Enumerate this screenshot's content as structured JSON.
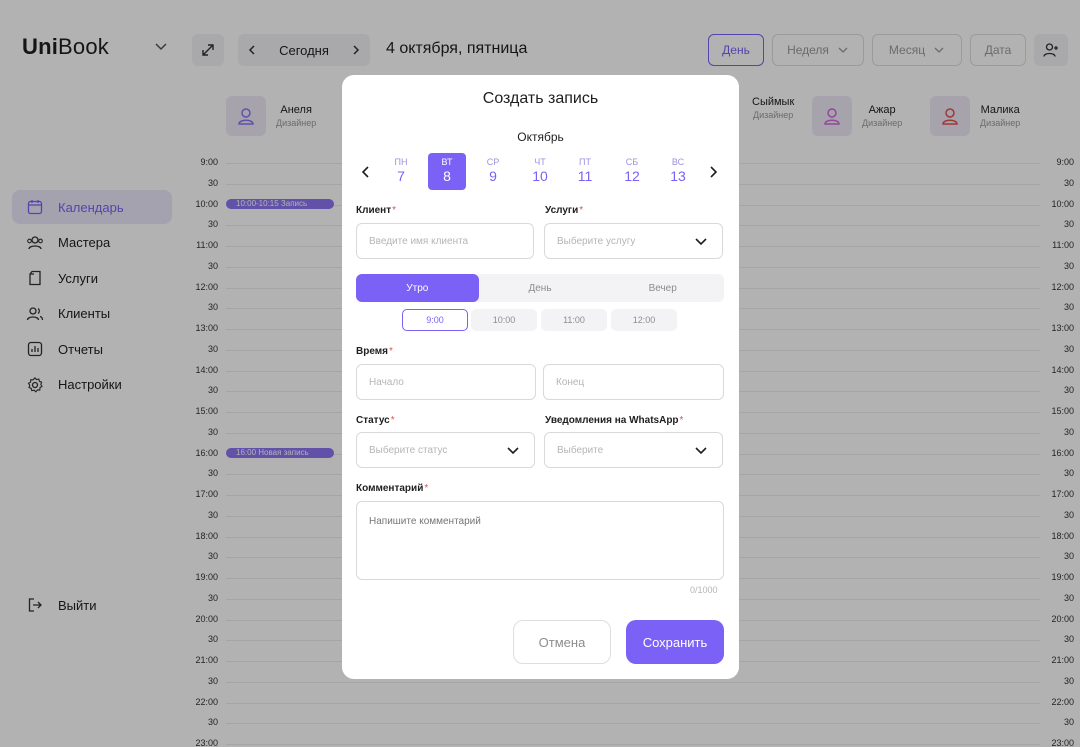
{
  "app": {
    "logo_bold": "Uni",
    "logo_rest": "Book"
  },
  "sidebar": {
    "items": [
      {
        "label": "Календарь",
        "icon": "calendar-icon",
        "active": true
      },
      {
        "label": "Мастера",
        "icon": "users-icon"
      },
      {
        "label": "Услуги",
        "icon": "box-icon"
      },
      {
        "label": "Клиенты",
        "icon": "clients-icon"
      },
      {
        "label": "Отчеты",
        "icon": "chart-icon"
      },
      {
        "label": "Настройки",
        "icon": "gear-icon"
      }
    ],
    "logout": "Выйти"
  },
  "topbar": {
    "today": "Сегодня",
    "date_title": "4 октября, пятница",
    "views": {
      "day": "День",
      "week": "Неделя",
      "month": "Месяц",
      "date": "Дата"
    }
  },
  "masters": [
    {
      "name": "Анеля",
      "role": "Дизайнер",
      "color": "#8b74f3"
    },
    {
      "name": "Сыймык",
      "role": "Дизайнер",
      "color": "#8b74f3"
    },
    {
      "name": "Ажар",
      "role": "Дизайнер",
      "color": "#d06ad8"
    },
    {
      "name": "Малика",
      "role": "Дизайнер",
      "color": "#e2524f"
    }
  ],
  "timeline": {
    "labels": [
      "9:00",
      "30",
      "10:00",
      "30",
      "11:00",
      "30",
      "12:00",
      "30",
      "13:00",
      "30",
      "14:00",
      "30",
      "15:00",
      "30",
      "16:00",
      "30",
      "17:00",
      "30",
      "18:00",
      "30",
      "19:00",
      "30",
      "20:00",
      "30",
      "21:00",
      "30",
      "22:00",
      "30",
      "23:00"
    ],
    "events": [
      {
        "text": "10:00-10:15 Запись",
        "slot": 2
      },
      {
        "text": "16:00 Новая запись",
        "slot": 14
      }
    ]
  },
  "modal": {
    "title": "Создать запись",
    "month": "Октябрь",
    "days": [
      {
        "name": "ПН",
        "num": "7"
      },
      {
        "name": "ВТ",
        "num": "8",
        "selected": true
      },
      {
        "name": "СР",
        "num": "9"
      },
      {
        "name": "ЧТ",
        "num": "10"
      },
      {
        "name": "ПТ",
        "num": "11"
      },
      {
        "name": "СБ",
        "num": "12"
      },
      {
        "name": "ВС",
        "num": "13"
      }
    ],
    "client_label": "Клиент",
    "client_placeholder": "Введите имя клиента",
    "services_label": "Услуги",
    "services_placeholder": "Выберите услугу",
    "periods": [
      "Утро",
      "День",
      "Вечер"
    ],
    "slots": [
      "9:00",
      "10:00",
      "11:00",
      "12:00"
    ],
    "time_label": "Время",
    "start_placeholder": "Начало",
    "end_placeholder": "Конец",
    "status_label": "Статус",
    "status_placeholder": "Выберите статус",
    "whatsapp_label": "Уведомления на WhatsApp",
    "whatsapp_placeholder": "Выберите",
    "comment_label": "Комментарий",
    "comment_placeholder": "Напишите комментарий",
    "counter": "0/1000",
    "cancel": "Отмена",
    "save": "Сохранить",
    "required_mark": "*"
  }
}
